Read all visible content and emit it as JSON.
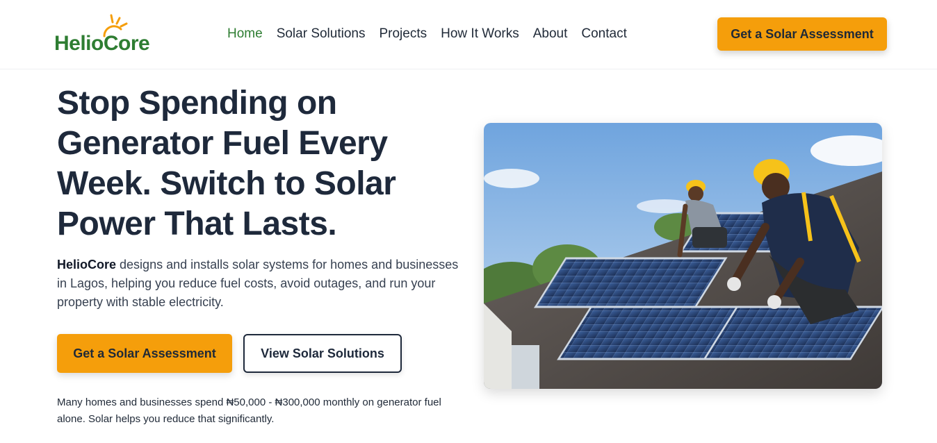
{
  "brand": {
    "name": "HelioCore",
    "color": "#2e7d32",
    "sun_color": "#f59e0b"
  },
  "nav": {
    "items": [
      {
        "label": "Home",
        "active": true
      },
      {
        "label": "Solar Solutions",
        "active": false
      },
      {
        "label": "Projects",
        "active": false
      },
      {
        "label": "How It Works",
        "active": false
      },
      {
        "label": "About",
        "active": false
      },
      {
        "label": "Contact",
        "active": false
      }
    ],
    "cta_label": "Get a Solar Assessment"
  },
  "hero": {
    "title": "Stop Spending on Generator Fuel Every Week. Switch to Solar Power That Lasts.",
    "description_brand": "HelioCore",
    "description_rest": " designs and installs solar systems for homes and businesses in Lagos, helping you reduce fuel costs, avoid outages, and run your property with stable electricity.",
    "primary_button": "Get a Solar Assessment",
    "secondary_button": "View Solar Solutions",
    "note": "Many homes and businesses spend ₦50,000 - ₦300,000 monthly on generator fuel alone. Solar helps you reduce that significantly.",
    "image_subject": "workers-installing-solar-panels-on-roof"
  },
  "colors": {
    "accent": "#f59e0b",
    "heading": "#1e293b",
    "active_nav": "#2e7d32"
  }
}
